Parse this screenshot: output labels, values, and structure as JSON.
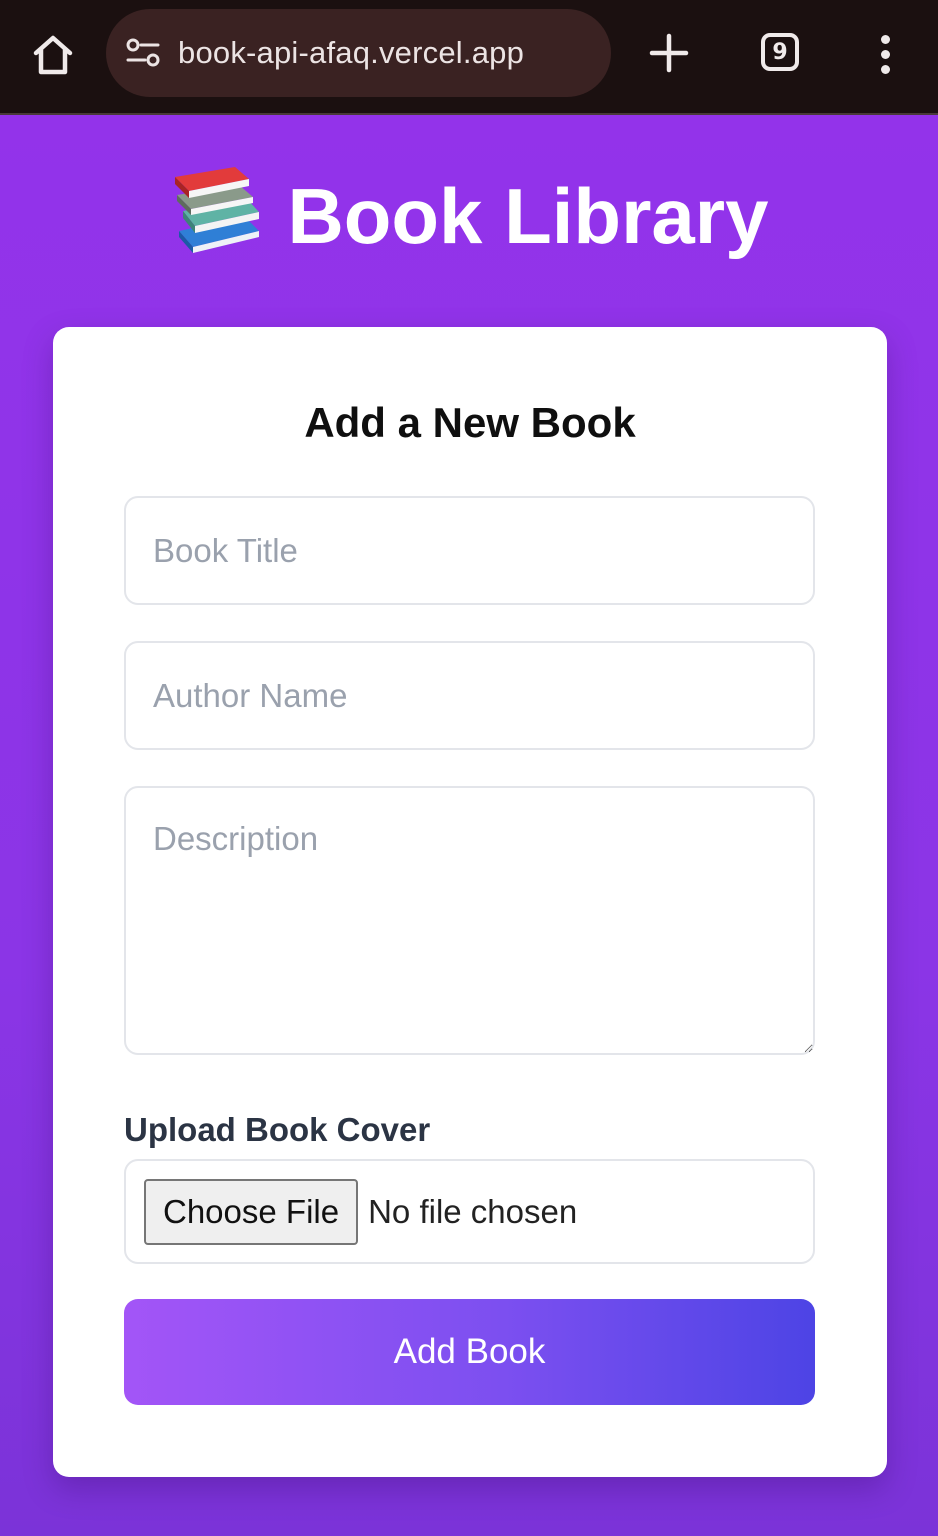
{
  "browser": {
    "url": "book-api-afaq.vercel.app",
    "tab_count": "9",
    "icons": {
      "home": "home-icon",
      "site_info": "site-settings-icon",
      "new_tab": "plus-icon",
      "tabs": "tab-switcher-icon",
      "menu": "more-vert-icon"
    },
    "colors": {
      "chrome_bg": "#1b1010",
      "url_pill": "#3a2222"
    }
  },
  "page": {
    "title": "Book Library",
    "title_icon": "books-icon",
    "colors": {
      "background": "#9333ea",
      "accent_start": "#a355f7",
      "accent_end": "#4d44e5"
    }
  },
  "form": {
    "heading": "Add a New Book",
    "title_placeholder": "Book Title",
    "title_value": "",
    "author_placeholder": "Author Name",
    "author_value": "",
    "description_placeholder": "Description",
    "description_value": "",
    "upload_label": "Upload Book Cover",
    "choose_file_label": "Choose File",
    "file_status": "No file chosen",
    "submit_label": "Add Book"
  }
}
